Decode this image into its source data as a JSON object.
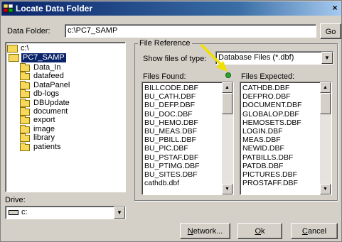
{
  "window": {
    "title": "Locate Data Folder",
    "close_glyph": "×"
  },
  "data_folder": {
    "label": "Data Folder:",
    "value": "c:\\PC7_SAMP",
    "go_label": "Go"
  },
  "folder_tree": {
    "root": "c:\\",
    "selected": "PC7_SAMP",
    "children": [
      "Data_In",
      "datafeed",
      "DataPanel",
      "db-logs",
      "DBUpdate",
      "document",
      "export",
      "image",
      "library",
      "patients"
    ]
  },
  "drive": {
    "label": "Drive:",
    "value": "c:"
  },
  "file_reference": {
    "group_label": "File Reference",
    "show_label": "Show files of type:",
    "file_type": "Database Files (*.dbf)",
    "found_label": "Files Found:",
    "expected_label": "Files Expected:",
    "status_color": "#2aa52a",
    "files_found": [
      "BILLCODE.DBF",
      "BU_CATH.DBF",
      "BU_DEFP.DBF",
      "BU_DOC.DBF",
      "BU_HEMO.DBF",
      "BU_MEAS.DBF",
      "BU_PBILL.DBF",
      "BU_PIC.DBF",
      "BU_PSTAF.DBF",
      "BU_PTIMG.DBF",
      "BU_SITES.DBF",
      "cathdb.dbf"
    ],
    "files_expected": [
      "CATHDB.DBF",
      "DEFPRO.DBF",
      "DOCUMENT.DBF",
      "GLOBALOP.DBF",
      "HEMOSETS.DBF",
      "LOGIN.DBF",
      "MEAS.DBF",
      "NEWID.DBF",
      "PATBILLS.DBF",
      "PATDB.DBF",
      "PICTURES.DBF",
      "PROSTAFF.DBF"
    ]
  },
  "buttons": {
    "network_prefix": "",
    "network_key": "N",
    "network_rest": "etwork...",
    "ok_prefix": "",
    "ok_key": "O",
    "ok_rest": "k",
    "cancel_prefix": "",
    "cancel_key": "C",
    "cancel_rest": "ancel"
  },
  "colors": {
    "titlebar": "#0a246a",
    "selection": "#0a246a",
    "annotation_arrow": "#f0e000"
  }
}
